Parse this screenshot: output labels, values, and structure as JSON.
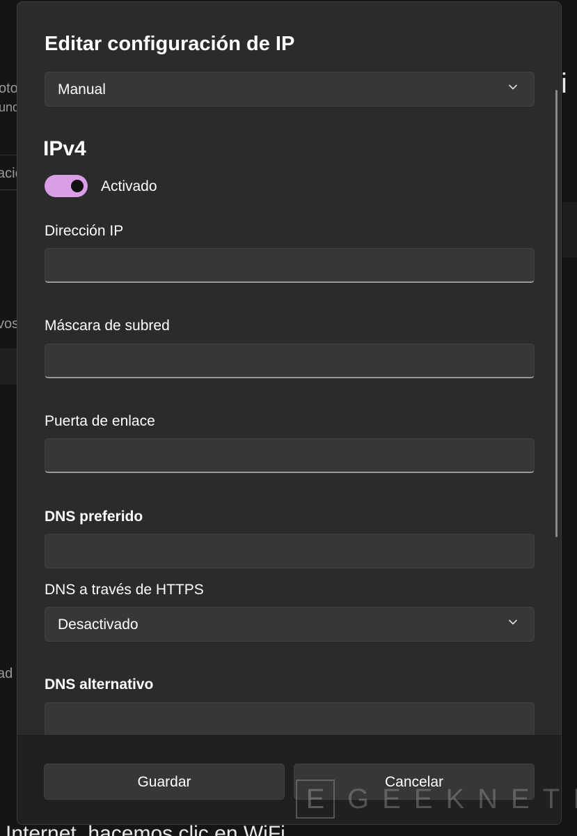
{
  "background": {
    "fragments": [
      "oto",
      "und",
      "acio",
      "vos",
      "ad"
    ],
    "bottom_text": "Internet, hacemos clic en WiFi",
    "right_glyph": "i"
  },
  "dialog": {
    "title": "Editar configuración de IP",
    "mode_select": {
      "value": "Manual",
      "icon": "chevron-down-icon"
    },
    "ipv4": {
      "heading": "IPv4",
      "toggle": {
        "state": "on",
        "label": "Activado"
      },
      "fields": {
        "ip_address": {
          "label": "Dirección IP",
          "value": ""
        },
        "subnet_mask": {
          "label": "Máscara de subred",
          "value": ""
        },
        "gateway": {
          "label": "Puerta de enlace",
          "value": ""
        },
        "preferred_dns": {
          "label": "DNS preferido",
          "value": ""
        },
        "dns_https": {
          "label": "DNS a través de HTTPS",
          "value": "Desactivado",
          "icon": "chevron-down-icon"
        },
        "alternate_dns": {
          "label": "DNS alternativo",
          "value": ""
        }
      }
    },
    "buttons": {
      "save": "Guardar",
      "cancel": "Cancelar"
    }
  },
  "watermark": {
    "mark": "E",
    "text": "GEEKNETIC"
  },
  "colors": {
    "dialog_bg": "#2b2b2b",
    "control_bg": "#373737",
    "footer_bg": "#202020",
    "toggle_on": "#d99ee6",
    "text": "#ffffff"
  }
}
